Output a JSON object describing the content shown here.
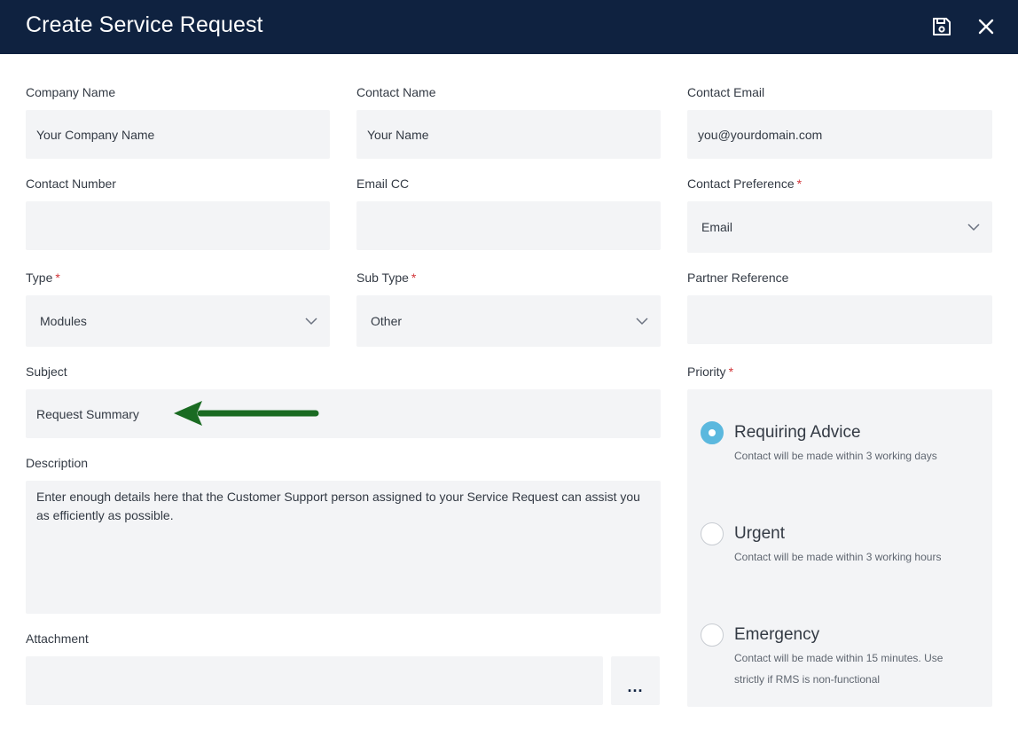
{
  "header": {
    "title": "Create Service Request",
    "save_icon": "save-icon",
    "close_icon": "close-icon"
  },
  "fields": {
    "company_name": {
      "label": "Company Name",
      "value": "Your Company Name"
    },
    "contact_name": {
      "label": "Contact Name",
      "value": "Your Name"
    },
    "contact_email": {
      "label": "Contact Email",
      "value": "you@yourdomain.com"
    },
    "contact_number": {
      "label": "Contact Number",
      "value": ""
    },
    "email_cc": {
      "label": "Email CC",
      "value": ""
    },
    "contact_preference": {
      "label": "Contact Preference",
      "required": "*",
      "value": "Email"
    },
    "type": {
      "label": "Type",
      "required": "*",
      "value": "Modules"
    },
    "sub_type": {
      "label": "Sub Type",
      "required": "*",
      "value": "Other"
    },
    "partner_reference": {
      "label": "Partner Reference",
      "value": ""
    },
    "subject": {
      "label": "Subject",
      "value": "Request Summary"
    },
    "description": {
      "label": "Description",
      "value": "Enter enough details here that the Customer Support person assigned to your Service Request can assist you as efficiently as possible."
    },
    "attachment": {
      "label": "Attachment",
      "value": "",
      "browse_label": "..."
    }
  },
  "priority": {
    "label": "Priority",
    "required": "*",
    "selected": "Requiring Advice",
    "options": [
      {
        "label": "Requiring Advice",
        "desc": "Contact will be made within 3 working days",
        "checked": true
      },
      {
        "label": "Urgent",
        "desc": "Contact will be made within 3 working hours",
        "checked": false
      },
      {
        "label": "Emergency",
        "desc": "Contact will be made within 15 minutes. Use strictly if RMS is non-functional",
        "checked": false
      }
    ]
  },
  "colors": {
    "header_bg": "#0f2240",
    "field_bg": "#f3f4f6",
    "required": "#d13438",
    "radio_selected": "#5bb8de",
    "annotation_arrow": "#1a6b22"
  },
  "annotation": {
    "icon": "arrow-left-icon"
  }
}
